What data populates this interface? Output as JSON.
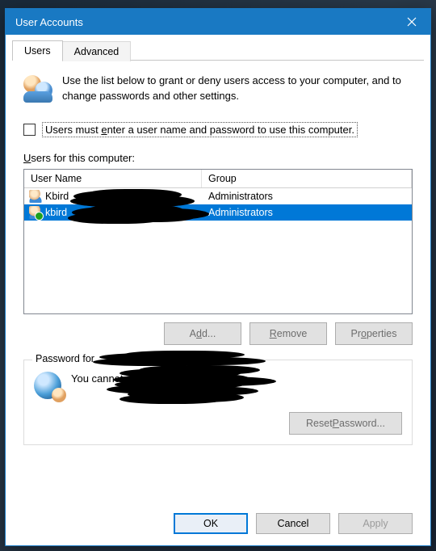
{
  "titlebar": {
    "title": "User Accounts"
  },
  "tabs": {
    "users": "Users",
    "advanced": "Advanced"
  },
  "intro": "Use the list below to grant or deny users access to your computer, and to change passwords and other settings.",
  "checkbox": {
    "pre": "Users must ",
    "e": "e",
    "post": "nter a user name and password to use this computer."
  },
  "listlabel": {
    "u": "U",
    "rest": "sers for this computer:"
  },
  "grid": {
    "headers": {
      "user": "User Name",
      "group": "Group"
    },
    "rows": [
      {
        "name": "Kbird",
        "group": "Administrators",
        "selected": false
      },
      {
        "name": "kbird",
        "group": "Administrators",
        "selected": true
      }
    ]
  },
  "buttons": {
    "add_pre": "A",
    "add_u": "d",
    "add_post": "d...",
    "remove_pre": "",
    "remove_u": "R",
    "remove_post": "emove",
    "props_pre": "Pr",
    "props_u": "o",
    "props_post": "perties",
    "reset_pre": "Reset ",
    "reset_u": "P",
    "reset_post": "assword..."
  },
  "groupbox": {
    "legend_prefix": "Password for",
    "body_text": "You cannot change the password for"
  },
  "footer": {
    "ok": "OK",
    "cancel": "Cancel",
    "apply_pre": "",
    "apply_u": "A",
    "apply_post": "pply"
  }
}
